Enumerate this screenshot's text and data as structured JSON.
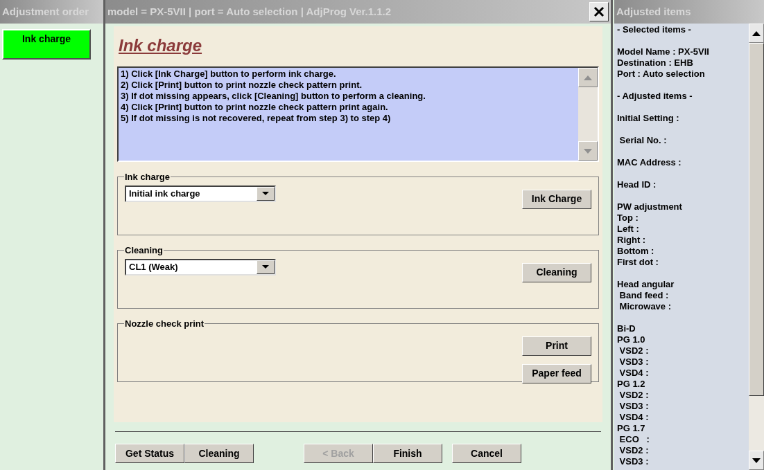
{
  "sidebar": {
    "title": "Adjustment order",
    "items": [
      {
        "label": "Ink charge",
        "selected": true
      }
    ]
  },
  "main": {
    "title": "model = PX-5VII | port = Auto selection | AdjProg Ver.1.1.2",
    "heading": "Ink charge",
    "instructions": [
      "1) Click [Ink Charge] button to perform ink charge.",
      "2) Click [Print] button to print nozzle check pattern print.",
      "3) If dot missing appears, click [Cleaning] button to perform a cleaning.",
      "4) Click [Print] button to print nozzle check pattern print again.",
      "5) If dot missing is not recovered, repeat from step 3) to step 4)"
    ],
    "groups": [
      {
        "title": "Ink charge",
        "dropdown": "Initial ink charge",
        "buttons": [
          "Ink Charge"
        ]
      },
      {
        "title": "Cleaning",
        "dropdown": "CL1 (Weak)",
        "buttons": [
          "Cleaning"
        ]
      },
      {
        "title": "Nozzle check print",
        "buttons": [
          "Print",
          "Paper feed"
        ]
      }
    ],
    "footer": [
      [
        {
          "label": "Get Status",
          "disabled": false
        },
        {
          "label": "Cleaning",
          "disabled": false
        }
      ],
      [
        {
          "label": "< Back",
          "disabled": true
        },
        {
          "label": "Finish",
          "disabled": false
        }
      ],
      [
        {
          "label": "Cancel",
          "disabled": false
        }
      ]
    ]
  },
  "adjusted": {
    "title": "Adjusted items",
    "sections": [
      [
        "- Selected items -"
      ],
      [
        "Model Name : PX-5VII",
        "Destination : EHB",
        "Port : Auto selection"
      ],
      [
        "- Adjusted items -"
      ],
      [
        "Initial Setting :"
      ],
      [
        " Serial No. :"
      ],
      [
        "MAC Address :"
      ],
      [
        "Head ID :"
      ],
      [
        "PW adjustment",
        "Top :",
        "Left :",
        "Right :",
        "Bottom :",
        "First dot :"
      ],
      [
        "Head angular",
        " Band feed :",
        " Microwave :"
      ],
      [
        "Bi-D",
        "PG 1.0",
        " VSD2 :",
        " VSD3 :",
        " VSD4 :",
        "PG 1.2",
        " VSD2 :",
        " VSD3 :",
        " VSD4 :",
        "PG 1.7",
        " ECO   :",
        " VSD2 :",
        " VSD3 :"
      ]
    ]
  }
}
